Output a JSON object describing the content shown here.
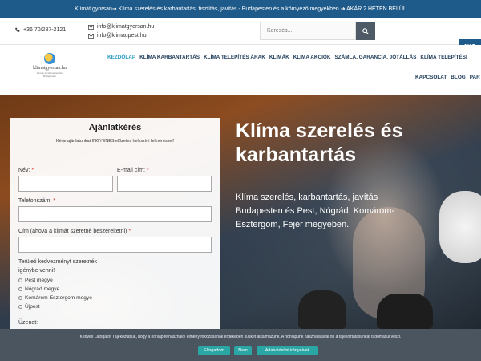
{
  "topbar": {
    "text": "Klímát gyorsan➜ Klíma szerelés és karbantartás, tisztítás, javítás - Budapesten és a környező megyékben ➜ AKÁR 2 HETEN BELÜL"
  },
  "contact": {
    "phone": "+36 70/287-2121",
    "email1": "info@klimatgyorsan.hu",
    "email2": "info@klimaupest.hu",
    "search_placeholder": "Keresés...",
    "akc_label": "AKC"
  },
  "logo": {
    "text": "klimatgyorsan.hu",
    "sub": "klímák és klímaszerelés Budapesten"
  },
  "nav": {
    "items": [
      "KEZDŐLAP",
      "KLÍMA KARBANTARTÁS",
      "KLÍMA TELEPÍTÉS ÁRAK",
      "KLÍMÁK",
      "KLÍMA AKCIÓK",
      "SZÁMLA, GARANCIA, JÓTÁLLÁS",
      "KLÍMA TELEPÍTÉSI"
    ],
    "items2": [
      "KAPCSOLAT",
      "BLOG",
      "PAR"
    ]
  },
  "hero": {
    "title": "Klíma szerelés és karbantartás",
    "subtitle": "Klíma szerelés, karbantartás, javítás Budapesten és Pest, Nógrád, Komárom-Esztergom, Fejér megyében."
  },
  "form": {
    "title": "Ajánlatkérés",
    "lead": "Kérje ajánlatunkat INGYENES előzetes helyszíni felméréssel!",
    "name_label": "Név:",
    "email_label": "E-mail cím:",
    "phone_label": "Telefonszám:",
    "address_label": "Cím (ahová a klímát szeretné beszereltetni)",
    "discount_label1": "Területi kedvezményt szeretnék",
    "discount_label2": "igénybe venni!",
    "options": [
      "Pest megye",
      "Nógrád megye",
      "Komárom-Esztergom megye",
      "Újpest"
    ],
    "message_label": "Üzenet:"
  },
  "cookie": {
    "text": "Kedves Látogató! Tájékoztatjuk, hogy a honlap felhasználói élmény fokozásának érdekében sütiket alkalmazunk. A honlapunk használatával ön a tájékoztatásunkat tudomásul veszi.",
    "accept": "Elfogadom",
    "deny": "Nem",
    "privacy": "Adatvédelmi irányelvek"
  },
  "colors": {
    "brand": "#1f5b8a",
    "accent": "#2aa6a5",
    "nav_active": "#2b9cc1"
  }
}
